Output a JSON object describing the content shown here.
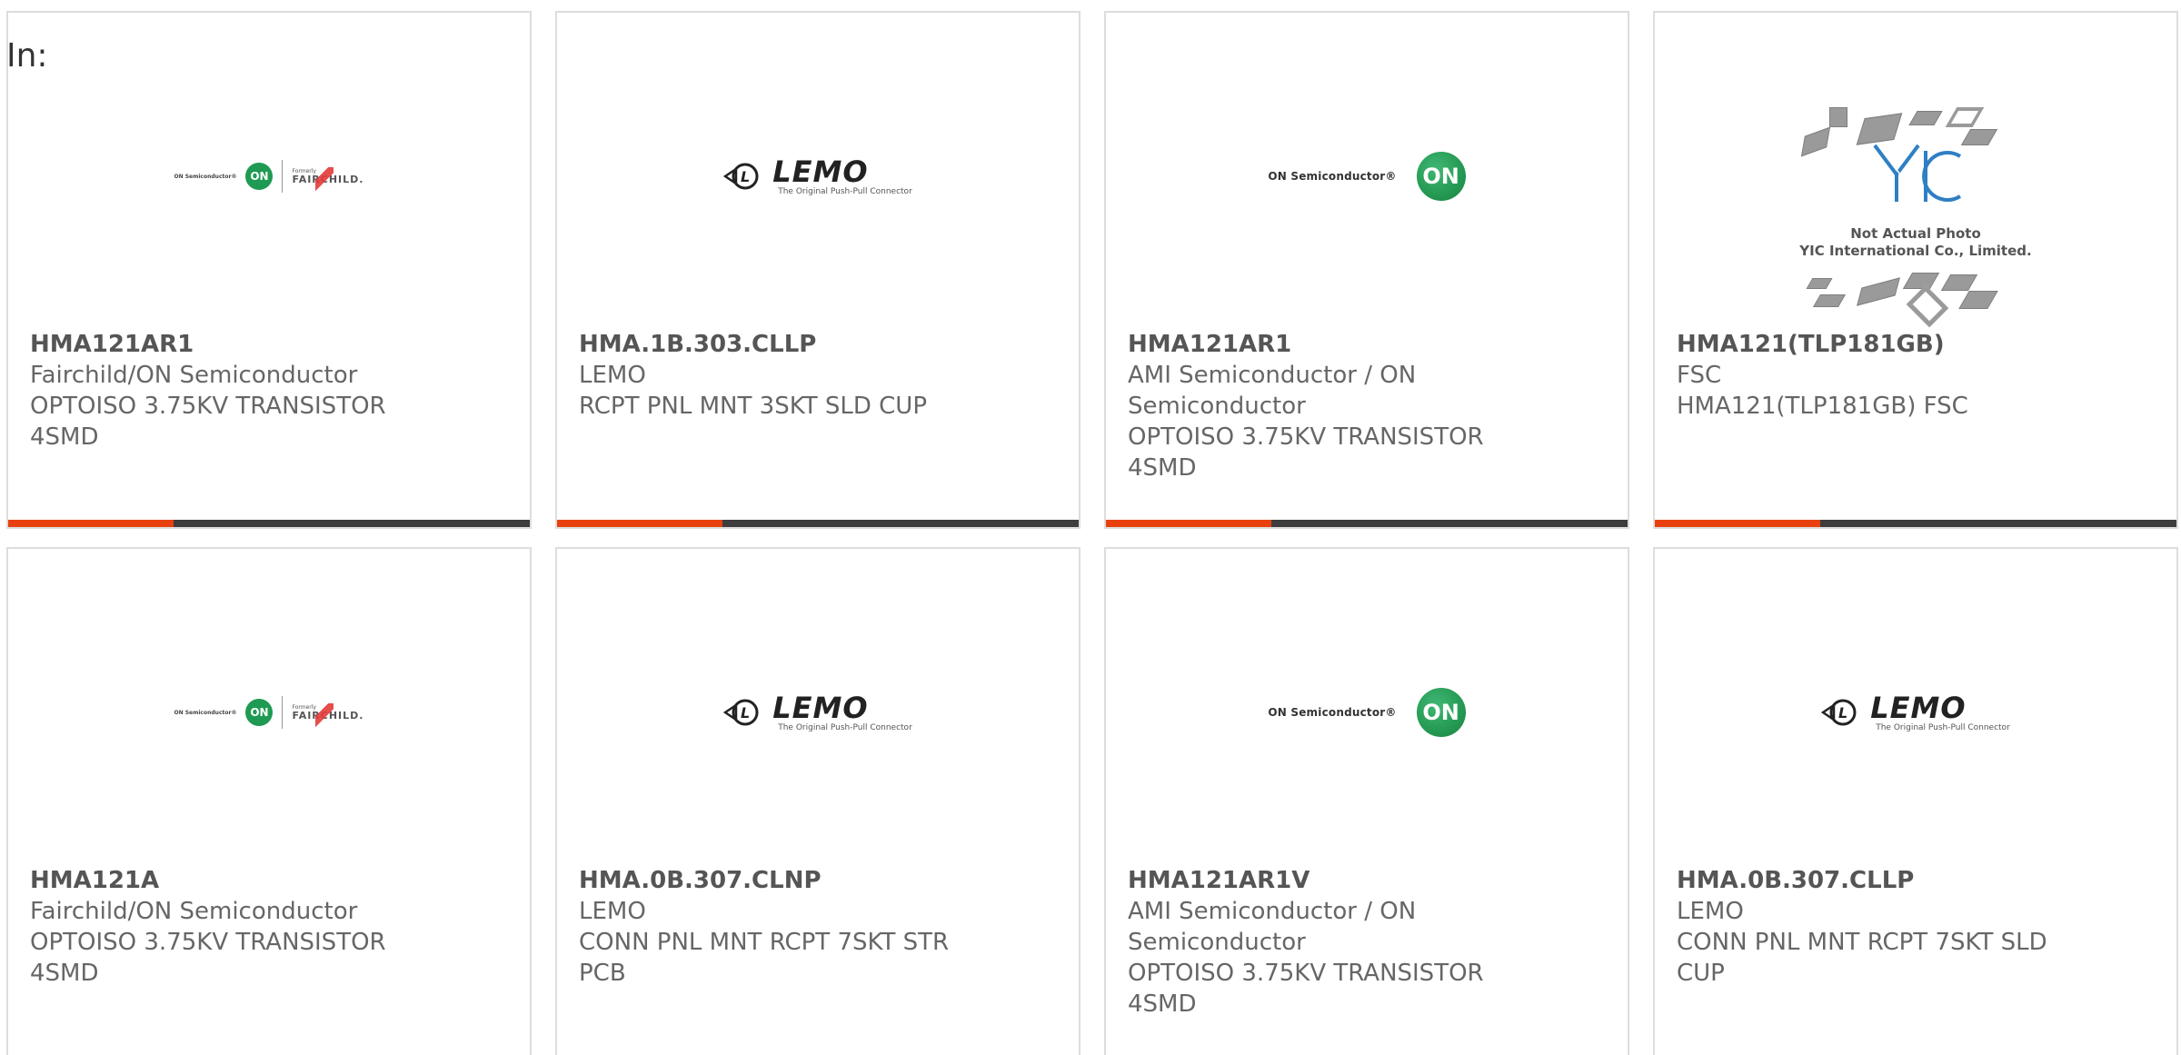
{
  "header": {
    "in_label": "In:"
  },
  "logos": {
    "on": {
      "text": "ON Semiconductor®",
      "badge": "ON"
    },
    "fairchild": {
      "on_text": "ON Semiconductor®",
      "badge": "ON",
      "formerly": "Formerly",
      "name": "FAIRCHILD."
    },
    "lemo": {
      "name": "LEMO",
      "tagline": "The Original Push-Pull Connector"
    },
    "yic": {
      "caption_line1": "Not Actual Photo",
      "caption_line2": "YIC International Co., Limited."
    }
  },
  "colors": {
    "accent": "#e8410f",
    "bar": "#3d3d3d",
    "border": "#dddddd",
    "text": "#666666"
  },
  "products": [
    {
      "part_number": "HMA121AR1",
      "manufacturer": "Fairchild/ON Semiconductor",
      "description": "OPTOISO 3.75KV TRANSISTOR 4SMD",
      "logo": "fairchild"
    },
    {
      "part_number": "HMA.1B.303.CLLP",
      "manufacturer": "LEMO",
      "description": "RCPT PNL MNT 3SKT SLD CUP",
      "logo": "lemo"
    },
    {
      "part_number": "HMA121AR1",
      "manufacturer": "AMI Semiconductor / ON Semiconductor",
      "description": "OPTOISO 3.75KV TRANSISTOR 4SMD",
      "logo": "on"
    },
    {
      "part_number": "HMA121(TLP181GB)",
      "manufacturer": "FSC",
      "description": "HMA121(TLP181GB) FSC",
      "logo": "yic"
    },
    {
      "part_number": "HMA121A",
      "manufacturer": "Fairchild/ON Semiconductor",
      "description": "OPTOISO 3.75KV TRANSISTOR 4SMD",
      "logo": "fairchild"
    },
    {
      "part_number": "HMA.0B.307.CLNP",
      "manufacturer": "LEMO",
      "description": "CONN PNL MNT RCPT 7SKT STR PCB",
      "logo": "lemo"
    },
    {
      "part_number": "HMA121AR1V",
      "manufacturer": "AMI Semiconductor / ON Semiconductor",
      "description": "OPTOISO 3.75KV TRANSISTOR 4SMD",
      "logo": "on"
    },
    {
      "part_number": "HMA.0B.307.CLLP",
      "manufacturer": "LEMO",
      "description": "CONN PNL MNT RCPT 7SKT SLD CUP",
      "logo": "lemo"
    }
  ]
}
